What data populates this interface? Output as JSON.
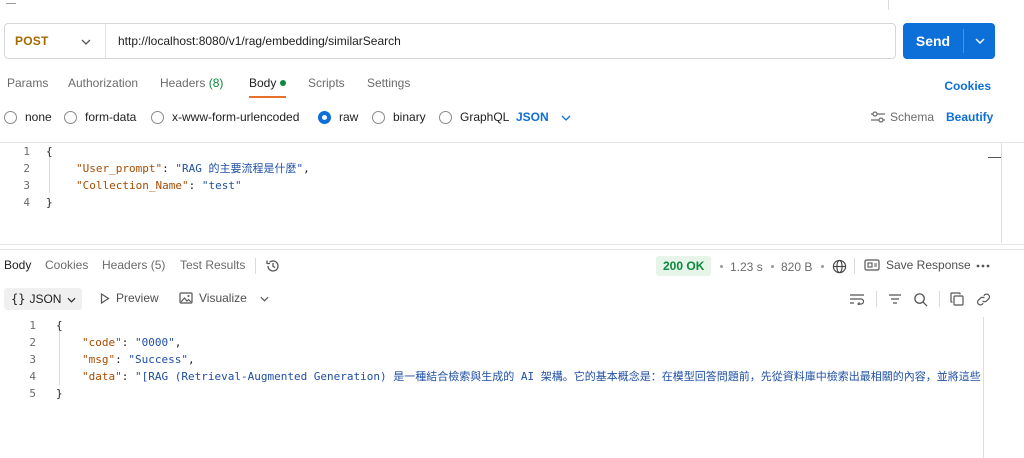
{
  "request": {
    "method": "POST",
    "url": "http://localhost:8080/v1/rag/embedding/similarSearch",
    "send_label": "Send"
  },
  "request_tabs": {
    "params": "Params",
    "authorization": "Authorization",
    "headers": "Headers",
    "headers_count": "(8)",
    "body": "Body",
    "scripts": "Scripts",
    "settings": "Settings",
    "cookies": "Cookies"
  },
  "body_types": {
    "none": "none",
    "form_data": "form-data",
    "urlencoded": "x-www-form-urlencoded",
    "raw": "raw",
    "binary": "binary",
    "graphql": "GraphQL",
    "format": "JSON",
    "schema": "Schema",
    "beautify": "Beautify"
  },
  "request_body": {
    "line_numbers": [
      "1",
      "2",
      "3",
      "4"
    ],
    "open": "{",
    "close": "}",
    "fields": [
      {
        "key": "\"User_prompt\"",
        "value": "\"RAG 的主要流程是什麼\""
      },
      {
        "key": "\"Collection_Name\"",
        "value": "\"test\""
      }
    ]
  },
  "response_tabs": {
    "body": "Body",
    "cookies": "Cookies",
    "headers": "Headers",
    "headers_count": "(5)",
    "test_results": "Test Results"
  },
  "response_meta": {
    "status": "200 OK",
    "time": "1.23 s",
    "size": "820 B",
    "save_response": "Save Response"
  },
  "response_view": {
    "format": "JSON",
    "braces": "{}",
    "preview": "Preview",
    "visualize": "Visualize"
  },
  "response_body": {
    "line_numbers": [
      "1",
      "2",
      "3",
      "4",
      "5"
    ],
    "open": "{",
    "close": "}",
    "fields": [
      {
        "key": "\"code\"",
        "value": "\"0000\"",
        "trail": ","
      },
      {
        "key": "\"msg\"",
        "value": "\"Success\"",
        "trail": ","
      },
      {
        "key": "\"data\"",
        "value": "\"[RAG (Retrieval-Augmented Generation) 是一種結合檢索與生成的 AI 架構。它的基本概念是：在模型回答問題前，先從資料庫中檢索出最相關的內容，並將這些內容",
        "trail": ""
      }
    ]
  },
  "colors": {
    "accent": "#0d6fd8",
    "method": "#a36b00",
    "status_ok": "#0b8a3a",
    "tab_underline": "#e8702a",
    "json_key": "#a64b00",
    "json_string": "#1f4fa3"
  },
  "icons": {
    "method_dropdown": "chevron-down-icon",
    "send_dropdown": "chevron-down-icon",
    "schema": "sliders-icon",
    "history": "history-icon",
    "globe": "globe-icon",
    "save": "save-response-icon",
    "more": "more-horizontal-icon",
    "preview": "play-triangle-icon",
    "visualize": "image-icon",
    "wrap": "wrap-lines-icon",
    "filter": "filter-icon",
    "search": "search-icon",
    "copy": "copy-icon",
    "link": "link-icon"
  }
}
